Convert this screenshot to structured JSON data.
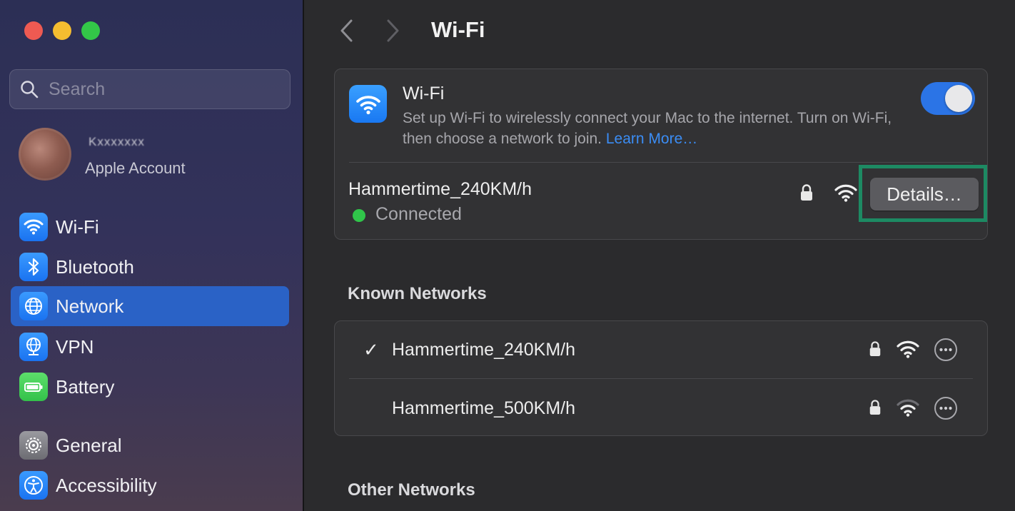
{
  "colors": {
    "accent": "#2a62c6",
    "toggle_on": "#2b74e6",
    "link": "#3b8df5",
    "connected": "#30c54a",
    "highlight": "#1d8a63"
  },
  "sidebar": {
    "search_placeholder": "Search",
    "account": {
      "name": "Kxxxxxxx",
      "subtitle": "Apple Account"
    },
    "items": [
      {
        "label": "Wi-Fi",
        "icon": "wifi-icon",
        "active": false
      },
      {
        "label": "Bluetooth",
        "icon": "bluetooth-icon",
        "active": false
      },
      {
        "label": "Network",
        "icon": "globe-icon",
        "active": true
      },
      {
        "label": "VPN",
        "icon": "vpn-globe-icon",
        "active": false
      },
      {
        "label": "Battery",
        "icon": "battery-icon",
        "active": false
      },
      {
        "label": "General",
        "icon": "gear-icon",
        "active": false
      },
      {
        "label": "Accessibility",
        "icon": "accessibility-icon",
        "active": false
      }
    ]
  },
  "header": {
    "title": "Wi-Fi"
  },
  "wifi_card": {
    "title": "Wi-Fi",
    "description": "Set up Wi-Fi to wirelessly connect your Mac to the internet. Turn on Wi-Fi, then choose a network to join.",
    "learn_more": "Learn More…",
    "toggle_on": true,
    "current_network": "Hammertime_240KM/h",
    "status": "Connected",
    "details_button": "Details…"
  },
  "known_networks": {
    "heading": "Known Networks",
    "items": [
      {
        "name": "Hammertime_240KM/h",
        "connected": true,
        "check": "✓"
      },
      {
        "name": "Hammertime_500KM/h",
        "connected": false,
        "check": ""
      }
    ]
  },
  "other_networks": {
    "heading": "Other Networks"
  }
}
